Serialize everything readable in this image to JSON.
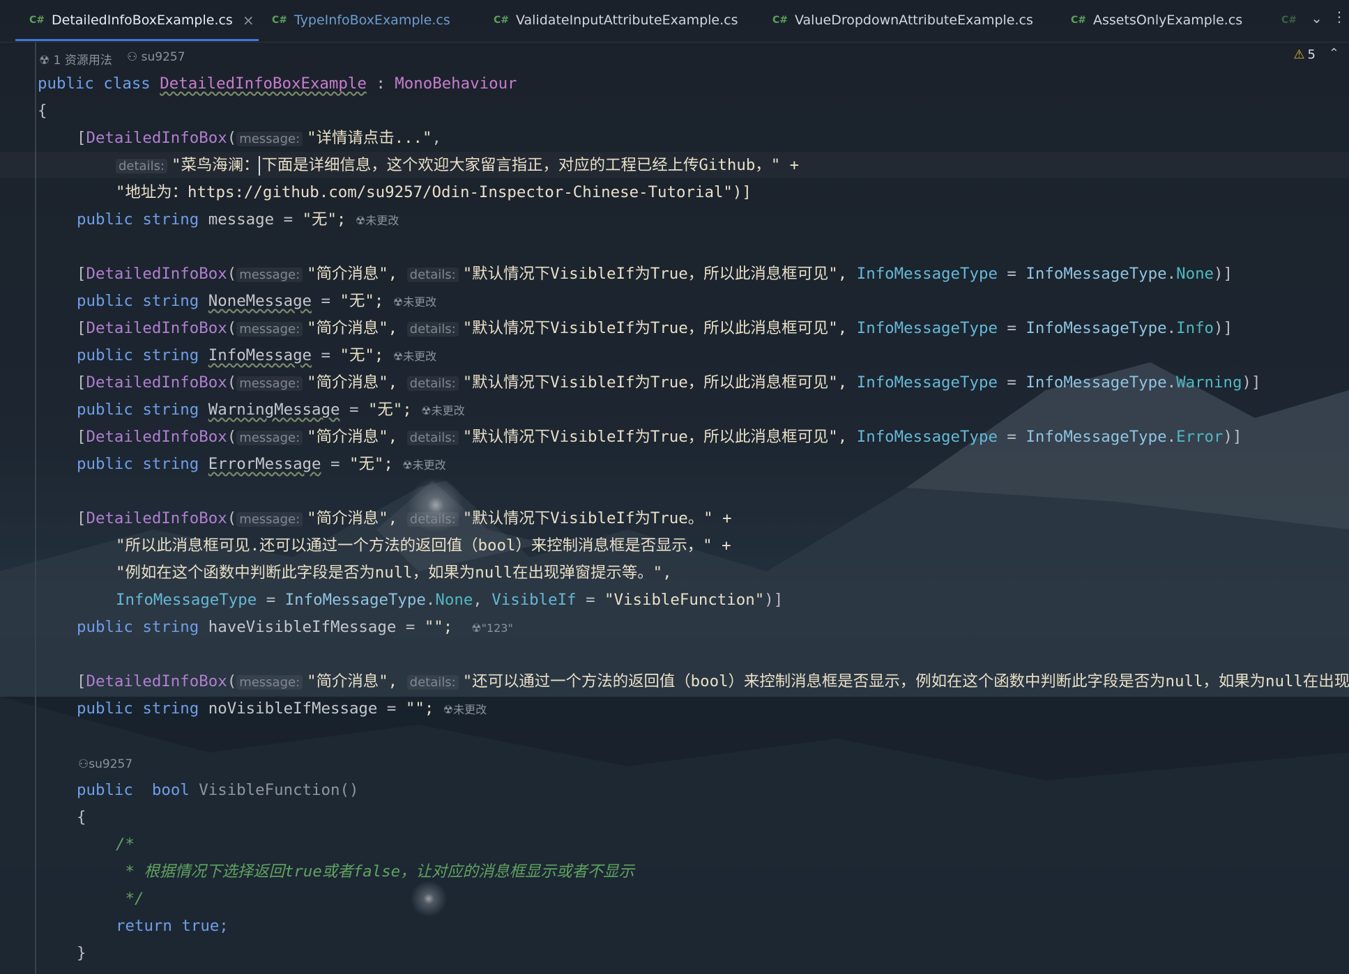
{
  "tabs": [
    {
      "lang": "C#",
      "label": "DetailedInfoBoxExample.cs",
      "active": true
    },
    {
      "lang": "C#",
      "label": "TypeInfoBoxExample.cs"
    },
    {
      "lang": "C#",
      "label": "ValidateInputAttributeExample.cs"
    },
    {
      "lang": "C#",
      "label": "ValueDropdownAttributeExample.cs"
    },
    {
      "lang": "C#",
      "label": "AssetsOnlyExample.cs"
    },
    {
      "lang": "C#",
      "label": ""
    }
  ],
  "hints": {
    "usage": "1 资源用法",
    "author1": "su9257",
    "author2": "su9257",
    "unchanged": "未更改",
    "value123": "\"123\""
  },
  "inlay": {
    "message": "message:",
    "details": "details:"
  },
  "warnings": {
    "count": "5"
  },
  "code": {
    "l1_public": "public",
    "l1_class": "class",
    "l1_name": "DetailedInfoBoxExample",
    "l1_colon": " : ",
    "l1_base": "MonoBehaviour",
    "brace_open": "{",
    "brace_close": "}",
    "attr": "DetailedInfoBox",
    "l3_msg": "\"详情请点击...\"",
    "l4_pre": "\"菜鸟海澜：",
    "l4_post": "下面是详细信息，这个欢迎大家留言指正，对应的工程已经上传Github，\" +",
    "l5": "\"地址为：https://github.com/su9257/Odin-Inspector-Chinese-Tutorial\")]",
    "public": "public",
    "string": "string",
    "bool": "bool",
    "f_message": "message",
    "f_none": "NoneMessage",
    "f_info": "InfoMessage",
    "f_warning": "WarningMessage",
    "f_error": "ErrorMessage",
    "f_have": "haveVisibleIfMessage",
    "f_no": "noVisibleIfMessage",
    "val_wu": "\"无\";",
    "val_empty": "\"\";",
    "eq": " = ",
    "s_brief": "\"简介消息\",",
    "s_default": "\"默认情况下VisibleIf为True，所以此消息框可见\",",
    "prop_type": "InfoMessageType",
    "enum_type": "InfoMessageType",
    "ev_none": "None",
    "ev_info": "Info",
    "ev_warning": "Warning",
    "ev_error": "Error",
    "s_vis1": "\"默认情况下VisibleIf为True。\" +",
    "s_vis2": "\"所以此消息框可见.还可以通过一个方法的返回值（bool）来控制消息框是否显示，\" +",
    "s_vis3": "\"例如在这个函数中判断此字段是否为null，如果为null在出现弹窗提示等。\",",
    "prop_visibleif": "VisibleIf",
    "s_visfn": "\"VisibleFunction\"",
    "s_long": "\"还可以通过一个方法的返回值（bool）来控制消息框是否显示，例如在这个函数中判断此字段是否为null，如果为null在出现",
    "method": "VisibleFunction()",
    "cmt1": "/*",
    "cmt2": " * 根据情况下选择返回true或者false，让对应的消息框显示或者不显示",
    "cmt3": " */",
    "ret": "return",
    "true": "true;"
  }
}
